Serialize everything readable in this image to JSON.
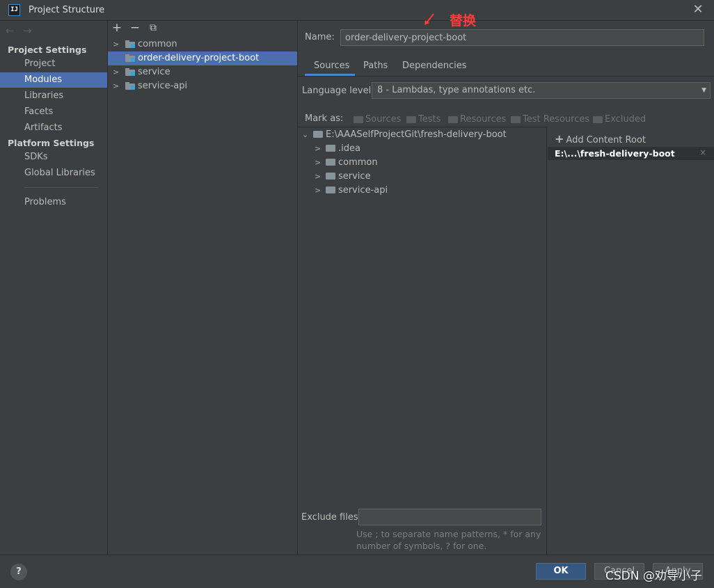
{
  "window": {
    "title": "Project Structure",
    "app_icon": "IJ",
    "close": "✕"
  },
  "annotation": {
    "text": "替换",
    "color": "#ff3b3b"
  },
  "nav": {
    "back": "←",
    "forward": "→"
  },
  "sidebar": {
    "project_settings_heading": "Project Settings",
    "project_items": [
      {
        "label": "Project"
      },
      {
        "label": "Modules",
        "selected": true
      },
      {
        "label": "Libraries"
      },
      {
        "label": "Facets"
      },
      {
        "label": "Artifacts"
      }
    ],
    "platform_settings_heading": "Platform Settings",
    "platform_items": [
      {
        "label": "SDKs"
      },
      {
        "label": "Global Libraries"
      }
    ],
    "problems": "Problems"
  },
  "module_toolbar": {
    "add": "+",
    "remove": "−",
    "copy": "⧉"
  },
  "modules": [
    {
      "label": "common",
      "expandable": true
    },
    {
      "label": "order-delivery-project-boot",
      "selected": true,
      "expandable": false
    },
    {
      "label": "service",
      "expandable": true
    },
    {
      "label": "service-api",
      "expandable": true
    }
  ],
  "name_field": {
    "label": "Name:",
    "value": "order-delivery-project-boot"
  },
  "tabs": [
    {
      "label": "Sources",
      "active": true
    },
    {
      "label": "Paths"
    },
    {
      "label": "Dependencies"
    }
  ],
  "language_level": {
    "label": "Language level:",
    "value": "8 - Lambdas, type annotations etc."
  },
  "mark_as": {
    "label": "Mark as:",
    "options": [
      "Sources",
      "Tests",
      "Resources",
      "Test Resources",
      "Excluded"
    ]
  },
  "content_tree": {
    "root": "E:\\AAASelfProjectGit\\fresh-delivery-boot",
    "children": [
      ".idea",
      "common",
      "service",
      "service-api"
    ]
  },
  "content_roots": {
    "add_label": "Add Content Root",
    "entry": "E:\\...\\fresh-delivery-boot",
    "remove": "×"
  },
  "exclude": {
    "label": "Exclude files:",
    "value": "",
    "hint_line1": "Use ; to separate name patterns, * for any",
    "hint_line2": "number of symbols, ? for one."
  },
  "footer": {
    "help": "?",
    "ok": "OK",
    "cancel": "Cancel",
    "apply": "Apply",
    "watermark": "CSDN @劝导小子"
  },
  "colors": {
    "background": "#3c3f41",
    "selection": "#4b6eaf",
    "ok_button": "#365880",
    "folder": "#87939a",
    "module_badge": "#3aa3d8"
  }
}
